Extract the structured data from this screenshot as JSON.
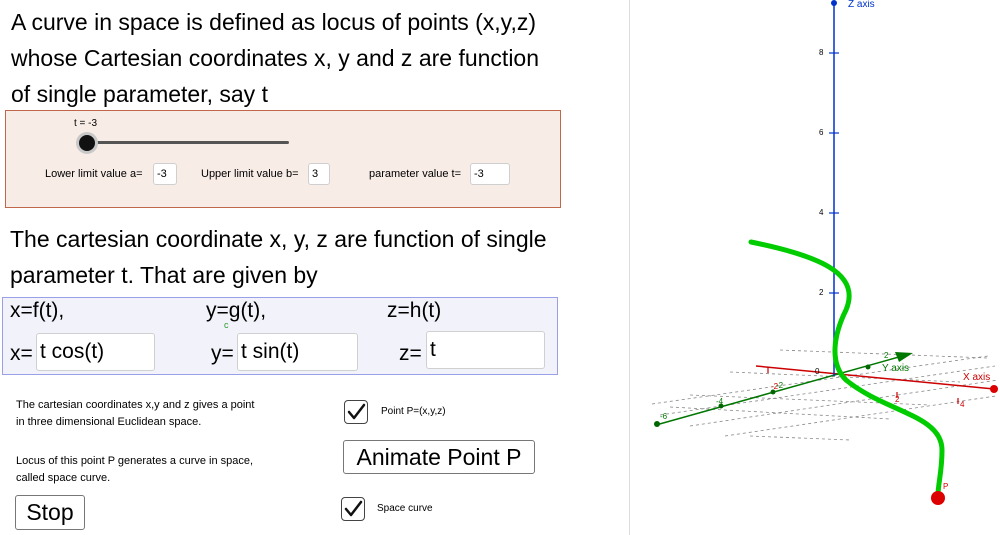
{
  "intro": {
    "line1": "A curve in space is defined as locus of points (x,y,z)",
    "line2": "whose Cartesian coordinates x, y and z are function",
    "line3": "of single parameter, say t"
  },
  "slider": {
    "label": "t = -3",
    "value": -3,
    "min": -3,
    "max": 3,
    "lower_label": "Lower limit value a=",
    "lower_value": "-3",
    "upper_label": "Upper limit value b=",
    "upper_value": "3",
    "param_label": "parameter value t=",
    "param_value": "-3"
  },
  "description": {
    "line1": "The cartesian coordinate x, y, z are function of single",
    "line2": "parameter t. That are given by"
  },
  "functions": {
    "fx_label": "x=f(t),",
    "gy_label": "y=g(t),",
    "hz_label": "z=h(t)",
    "sub_c": "c",
    "x_prefix": "x=",
    "x_value": "t cos(t)",
    "y_prefix": "y=",
    "y_value": "t sin(t)",
    "z_prefix": "z=",
    "z_value": "t"
  },
  "notes": {
    "note1_line1": "The cartesian coordinates x,y and z gives a point",
    "note1_line2": "in three dimensional Euclidean space.",
    "note2_line1": "Locus of this point P generates a curve in space,",
    "note2_line2": "called space curve."
  },
  "controls": {
    "point_checkbox_label": "Point P=(x,y,z)",
    "point_checked": true,
    "animate_button": "Animate Point P",
    "stop_button": "Stop",
    "curve_checkbox_label": "Space curve",
    "curve_checked": true
  },
  "graph": {
    "z_axis_label": "Z axis",
    "y_axis_label": "Y axis",
    "x_axis_label": "X axis",
    "origin_label": "0",
    "point_label": "P",
    "z_ticks": [
      "2",
      "4",
      "6",
      "8"
    ],
    "x_ticks": [
      "2",
      "4"
    ],
    "x_neg_ticks": [
      "-2"
    ],
    "y_ticks": [
      "2"
    ],
    "y_neg_ticks": [
      "-2",
      "-4",
      "-6"
    ],
    "colors": {
      "x_axis": "#cc0000",
      "y_axis": "#007700",
      "z_axis": "#0033cc",
      "curve": "#00cc00",
      "point": "#dd0000"
    }
  }
}
